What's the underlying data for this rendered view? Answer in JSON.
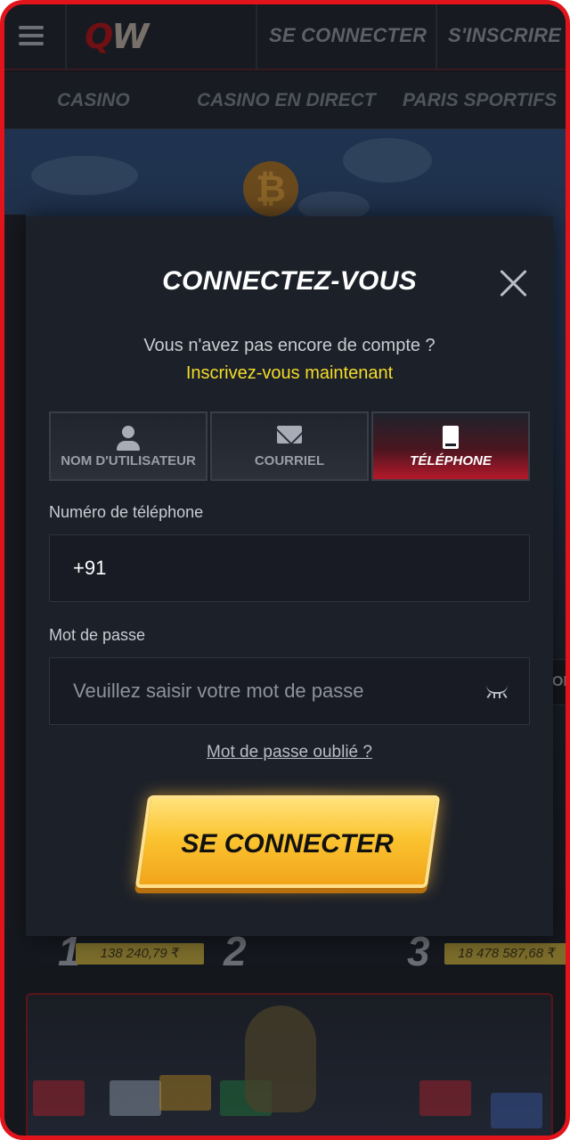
{
  "header": {
    "logo_text_q": "Q",
    "logo_text_w": "W",
    "login_link": "SE CONNECTER",
    "register_link": "S'INSCRIRE"
  },
  "nav": {
    "items": [
      "CASINO",
      "CASINO EN DIRECT",
      "PARIS SPORTIFS"
    ]
  },
  "background": {
    "coin_symbol": "₿",
    "ranks": [
      "1",
      "2",
      "3"
    ],
    "amounts": [
      "138 240,79 ₹",
      "18 478 587,68 ₹"
    ],
    "side_stub_text": "OL"
  },
  "modal": {
    "title": "CONNECTEZ-VOUS",
    "no_account_text": "Vous n'avez pas encore de compte ?",
    "signup_link": "Inscrivez-vous maintenant",
    "tabs": [
      {
        "label": "NOM D'UTILISATEUR",
        "icon": "user-icon",
        "selected": false
      },
      {
        "label": "COURRIEL",
        "icon": "mail-icon",
        "selected": false
      },
      {
        "label": "TÉLÉPHONE",
        "icon": "phone-icon",
        "selected": true
      }
    ],
    "phone_label": "Numéro de téléphone",
    "phone_value": "+91",
    "password_label": "Mot de passe",
    "password_placeholder": "Veuillez saisir votre mot de passe",
    "forgot_link": "Mot de passe oublié ?",
    "submit_label": "SE CONNECTER"
  },
  "colors": {
    "frame_border": "#e1141c",
    "accent_yellow": "#f4dc2a",
    "selected_tab_red": "#b5182a",
    "button_gold": "#fbc431"
  }
}
